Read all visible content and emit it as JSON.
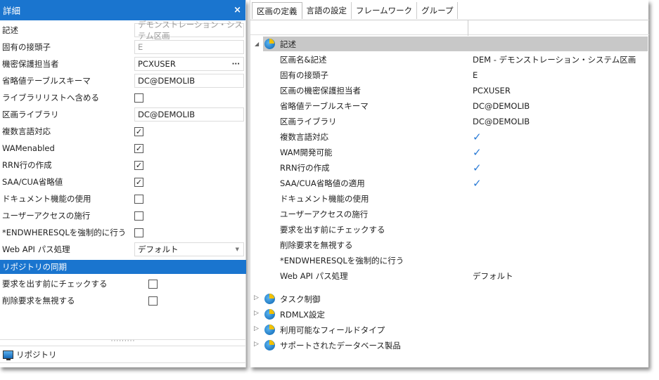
{
  "left": {
    "title": "詳細",
    "close": "×",
    "fields": [
      {
        "label": "記述",
        "type": "text",
        "value": "デモンストレーション・システム区画",
        "readonly": true
      },
      {
        "label": "固有の接頭子",
        "type": "text",
        "value": "E",
        "readonly": true
      },
      {
        "label": "機密保護担当者",
        "type": "lookup",
        "value": "PCXUSER",
        "button": "···"
      },
      {
        "label": "省略値テーブルスキーマ",
        "type": "text",
        "value": "DC@DEMOLIB"
      },
      {
        "label": "ライブラリリストへ含める",
        "type": "check",
        "checked": false
      },
      {
        "label": "区画ライブラリ",
        "type": "text",
        "value": "DC@DEMOLIB"
      },
      {
        "label": "複数言語対応",
        "type": "check",
        "checked": true
      },
      {
        "label": "WAMenabled",
        "type": "check",
        "checked": true
      },
      {
        "label": "RRN行の作成",
        "type": "check",
        "checked": true
      },
      {
        "label": "SAA/CUA省略値",
        "type": "check",
        "checked": true
      },
      {
        "label": "ドキュメント機能の使用",
        "type": "check",
        "checked": false
      },
      {
        "label": "ユーザーアクセスの施行",
        "type": "check",
        "checked": false
      },
      {
        "label": "*ENDWHERESQLを強制的に行う",
        "type": "check",
        "checked": false
      },
      {
        "label": "Web API パス処理",
        "type": "select",
        "value": "デフォルト"
      }
    ],
    "section": "リポジトリの同期",
    "sync": [
      {
        "label": "要求を出す前にチェックする",
        "checked": false
      },
      {
        "label": "削除要求を無視する",
        "checked": false
      }
    ],
    "splitter": "·········",
    "bottom_tab": "リポジトリ"
  },
  "right": {
    "tabs": [
      "区画の定義",
      "言語の設定",
      "フレームワーク",
      "グループ"
    ],
    "active_tab": 0,
    "group": "記述",
    "rows": [
      {
        "k": "区画名&記述",
        "v": "DEM - デモンストレーション・システム区画"
      },
      {
        "k": "固有の接頭子",
        "v": "E"
      },
      {
        "k": "区画の機密保護担当者",
        "v": "PCXUSER"
      },
      {
        "k": "省略値テーブルスキーマ",
        "v": "DC@DEMOLIB"
      },
      {
        "k": "区画ライブラリ",
        "v": "DC@DEMOLIB"
      },
      {
        "k": "複数言語対応",
        "check": true
      },
      {
        "k": "WAM開発可能",
        "check": true
      },
      {
        "k": "RRN行の作成",
        "check": true
      },
      {
        "k": "SAA/CUA省略値の適用",
        "check": true
      },
      {
        "k": "ドキュメント機能の使用",
        "v": ""
      },
      {
        "k": "ユーザーアクセスの施行",
        "v": ""
      },
      {
        "k": "要求を出す前にチェックする",
        "v": ""
      },
      {
        "k": "削除要求を無視する",
        "v": ""
      },
      {
        "k": "*ENDWHERESQLを強制的に行う",
        "v": ""
      },
      {
        "k": "Web API パス処理",
        "v": "デフォルト"
      }
    ],
    "collapsed_groups": [
      "タスク制御",
      "RDMLX設定",
      "利用可能なフィールドタイプ",
      "サポートされたデータベース製品"
    ],
    "checkmark": "✓"
  },
  "colors": {
    "accent": "#1a75cf",
    "selected_row": "#c8c8c8",
    "check": "#2a7bd6"
  }
}
